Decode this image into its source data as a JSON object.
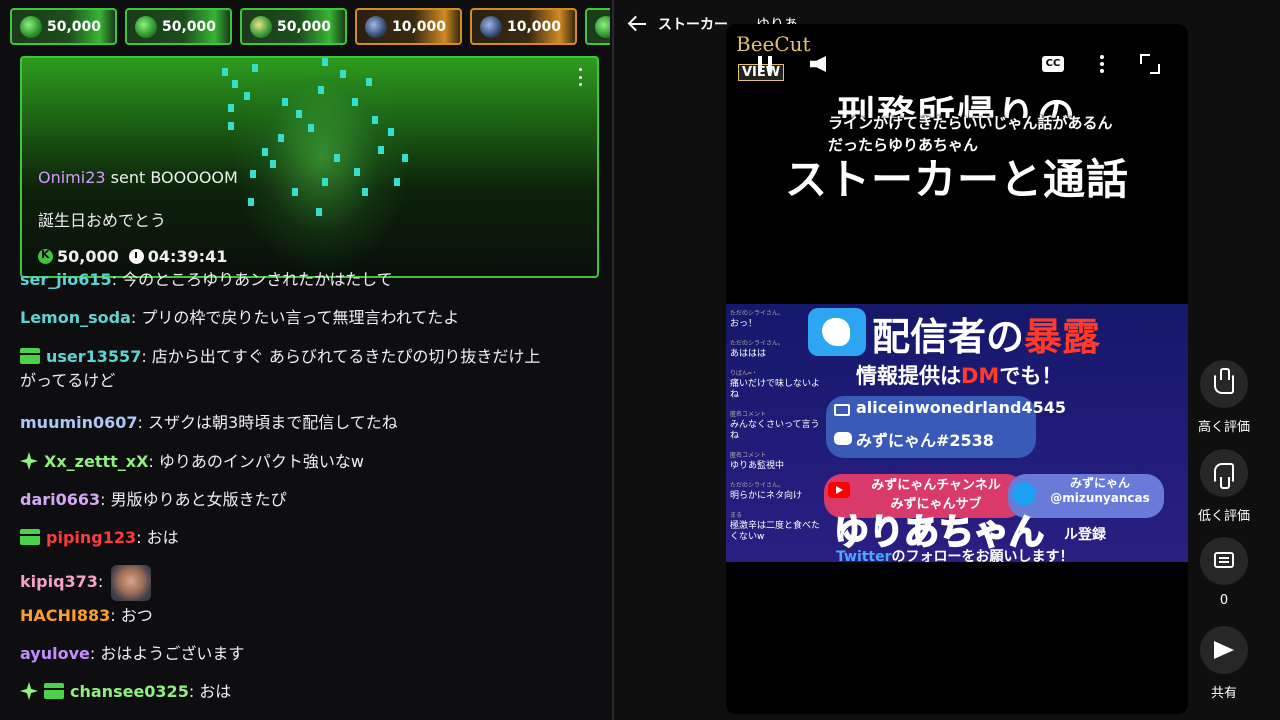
{
  "gift_bar": {
    "chips": [
      {
        "amount": "50,000",
        "style": "green",
        "icon": "g"
      },
      {
        "amount": "50,000",
        "style": "green",
        "icon": "g"
      },
      {
        "amount": "50,000",
        "style": "green",
        "icon": "g2"
      },
      {
        "amount": "10,000",
        "style": "gold",
        "icon": "b"
      },
      {
        "amount": "10,000",
        "style": "gold",
        "icon": "b"
      },
      {
        "amount": "",
        "style": "green",
        "icon": "g"
      }
    ]
  },
  "featured_gift": {
    "sender": "Onimi23",
    "action": " sent BOOOOOM",
    "message": "誕生日おめでとう",
    "amount": "50,000",
    "duration": "04:39:41",
    "accent_color": "#3fc73b"
  },
  "chat": {
    "messages": [
      {
        "user": "ser_jio615",
        "color": "#5fd3d3",
        "text": ": 今のところゆりあンされたかはたして",
        "badges": []
      },
      {
        "user": "Lemon_soda",
        "color": "#5fd3d3",
        "text": ": プリの枠で戻りたい言って無理言われてたよ",
        "badges": []
      },
      {
        "user": "user13557",
        "color": "#5fd3d3",
        "text": ": 店から出てすぐ あらびれてるきたぴの切り抜きだけ上",
        "text2": "がってるけど",
        "badges": [
          "gift"
        ]
      },
      {
        "user": "muumin0607",
        "color": "#aac7f7",
        "text": ": スザクは朝3時頃まで配信してたね",
        "badges": []
      },
      {
        "user": "Xx_zettt_xX",
        "color": "#8ef07d",
        "text": ": ゆりあのインパクト強いなw",
        "badges": [
          "star"
        ]
      },
      {
        "user": "dari0663",
        "color": "#d5a7f7",
        "text": ": 男版ゆりあと女版きたぴ",
        "badges": []
      },
      {
        "user": "piping123",
        "color": "#ff3a3a",
        "text": ": おは",
        "badges": [
          "gift"
        ]
      },
      {
        "user": "kipiq373",
        "color": "#f7a0c8",
        "text": ":",
        "badges": [],
        "emote": "face-emote"
      },
      {
        "user": "HACHI883",
        "color": "#ff9d2a",
        "text": ": おつ",
        "badges": []
      },
      {
        "user": "ayulove",
        "color": "#c58cff",
        "text": ": おはようございます",
        "badges": []
      },
      {
        "user": "chansee0325",
        "color": "#8ef07d",
        "text": ": おは",
        "badges": [
          "star",
          "gift"
        ]
      }
    ]
  },
  "player": {
    "header_title": "ストーカー",
    "header_sub": "ゆりあ",
    "watermark": "BeeCut",
    "watermark_badge": "VIEW",
    "cc_label": "CC",
    "video": {
      "title_top": "刑務所帰りの",
      "subtitle_line1": "ラインかけてきたらいいじゃん話があるん",
      "subtitle_line2": "だったらゆりあちゃん",
      "title_main": "ストーカーと通話",
      "banner_title_a": "配信者の",
      "banner_title_b": "暴露",
      "banner_sub_a": "情報提供は",
      "banner_sub_b": "DM",
      "banner_sub_c": "でも！",
      "email": "aliceinwonedrland4545",
      "discord": "みずにゃん#2538",
      "yt_line1": "みずにゃんチャンネル",
      "yt_line2": "みずにゃんサブ",
      "tw_line1": "みずにゃん",
      "tw_line2": "@mizunyancas",
      "overlay_name": "ゆりあちゃん",
      "register": "ル登録",
      "follow_a": "Twitter",
      "follow_b": "のフォローをお願いします！",
      "side_chat": [
        {
          "name": "ただのシライさん。",
          "text": "おっ！"
        },
        {
          "name": "ただのシライさん。",
          "text": "あははは"
        },
        {
          "name": "りばん━・",
          "text": "痛いだけで味しないよね"
        },
        {
          "name": "匿名コメント",
          "text": "みんなくさいって言うね"
        },
        {
          "name": "匿名コメント",
          "text": "ゆりあ監視中"
        },
        {
          "name": "ただのシライさん。",
          "text": "明らかにネタ向け"
        },
        {
          "name": "まる",
          "text": "極激辛は二度と食べたくないw"
        }
      ]
    }
  },
  "actions": {
    "like_label": "高く評価",
    "dislike_label": "低く評価",
    "comment_count": "0",
    "share_label": "共有"
  }
}
